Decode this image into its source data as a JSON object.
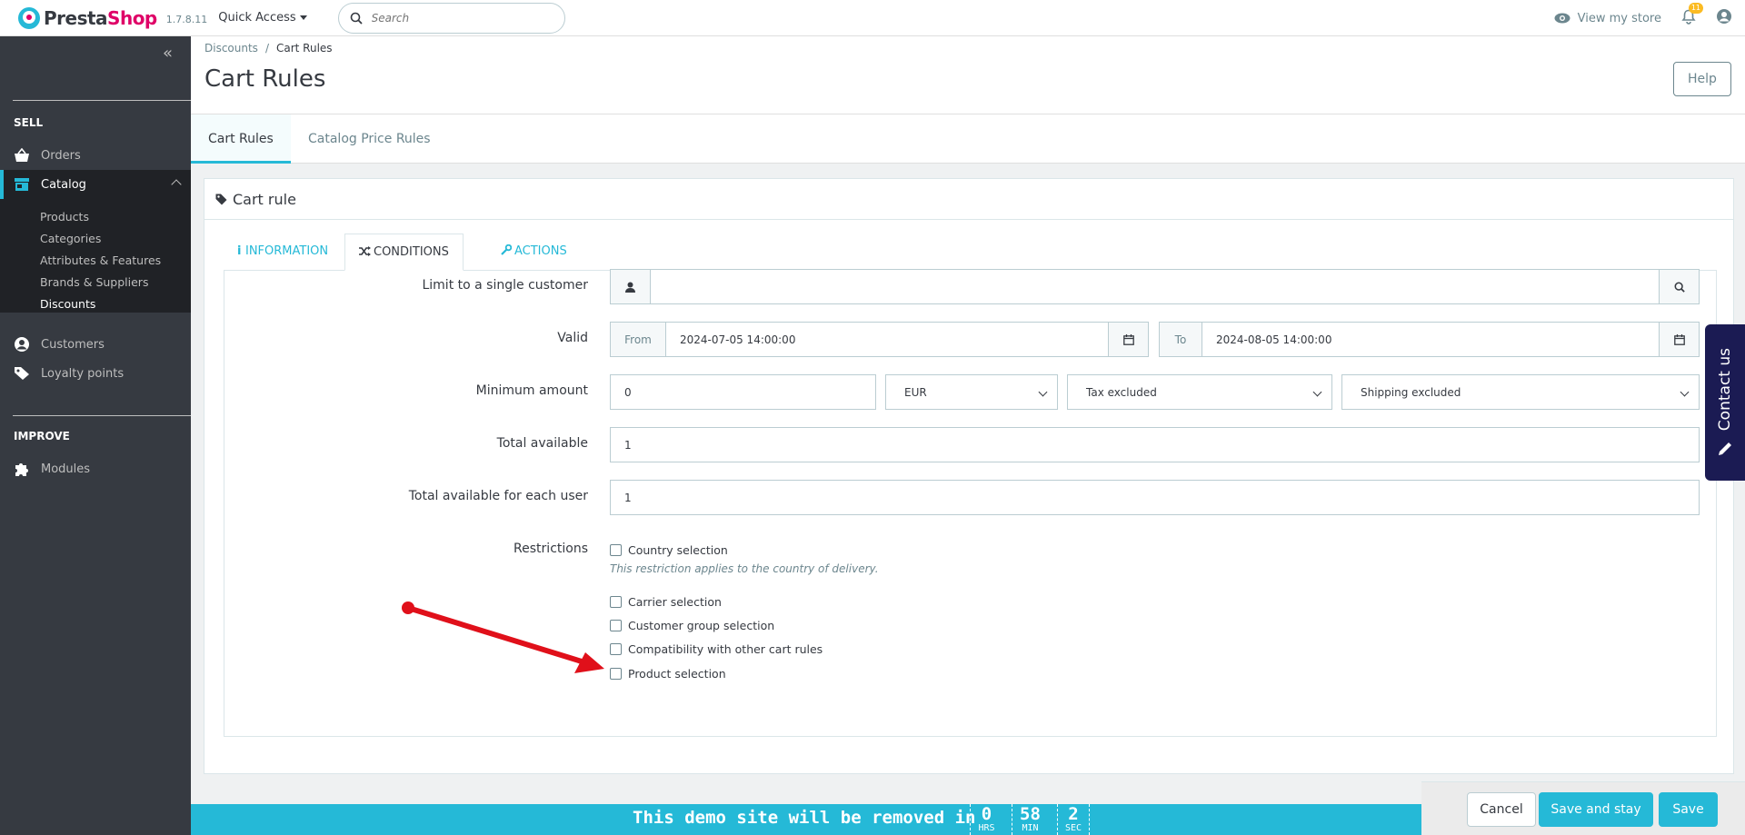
{
  "brand": {
    "name_part1": "Presta",
    "name_part2": "Shop",
    "version": "1.7.8.11"
  },
  "header": {
    "quick_access": "Quick Access",
    "search_placeholder": "Search",
    "view_store": "View my store",
    "notifications_count": "11"
  },
  "sidebar": {
    "sell_title": "SELL",
    "improve_title": "IMPROVE",
    "items": {
      "orders": "Orders",
      "catalog": "Catalog",
      "customers": "Customers",
      "loyalty": "Loyalty points",
      "modules": "Modules"
    },
    "catalog_sub": [
      "Products",
      "Categories",
      "Attributes & Features",
      "Brands & Suppliers",
      "Discounts"
    ]
  },
  "page": {
    "breadcrumb_parent": "Discounts",
    "breadcrumb_current": "Cart Rules",
    "title": "Cart Rules",
    "help_label": "Help",
    "tabs": [
      "Cart Rules",
      "Catalog Price Rules"
    ]
  },
  "card": {
    "title": "Cart rule",
    "tabs": [
      "INFORMATION",
      "CONDITIONS",
      "ACTIONS"
    ]
  },
  "form": {
    "limit_label": "Limit to a single customer",
    "limit_value": "",
    "valid_label": "Valid",
    "from_label": "From",
    "from_value": "2024-07-05 14:00:00",
    "to_label": "To",
    "to_value": "2024-08-05 14:00:00",
    "min_amount_label": "Minimum amount",
    "min_amount_value": "0",
    "currency": "EUR",
    "tax": "Tax excluded",
    "shipping": "Shipping excluded",
    "total_label": "Total available",
    "total_value": "1",
    "per_user_label": "Total available for each user",
    "per_user_value": "1",
    "restrictions_label": "Restrictions",
    "country": "Country selection",
    "country_help": "This restriction applies to the country of delivery.",
    "carrier": "Carrier selection",
    "customer_group": "Customer group selection",
    "compatibility": "Compatibility with other cart rules",
    "product": "Product selection"
  },
  "contact_us": "Contact us",
  "demo": {
    "text": "This demo site will be removed in",
    "hrs": "0",
    "hrs_unit": "HRS",
    "min": "58",
    "min_unit": "MIN",
    "sec": "2",
    "sec_unit": "SEC"
  },
  "actions": {
    "cancel": "Cancel",
    "save_stay": "Save and stay",
    "save": "Save"
  },
  "colors": {
    "accent": "#25b9d7",
    "sidebar": "#363a41",
    "brand_pink": "#df0067",
    "arrow": "#e0101a"
  }
}
